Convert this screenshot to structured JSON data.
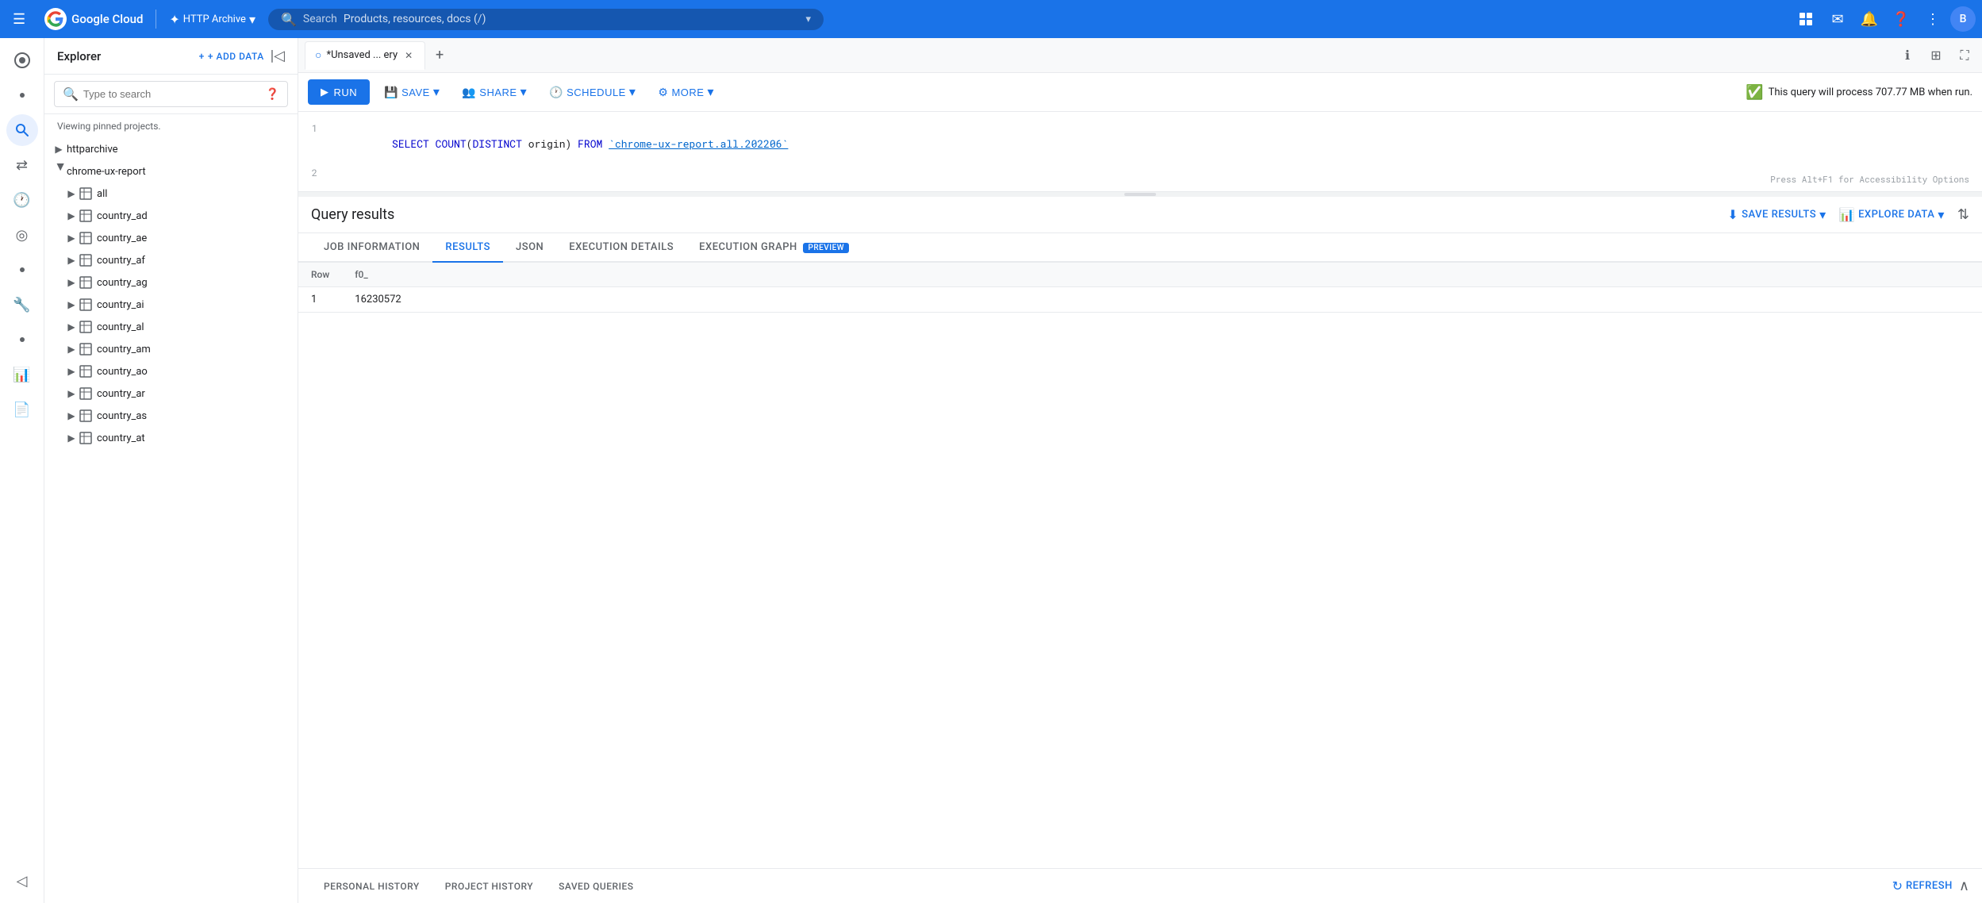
{
  "topNav": {
    "hamburger": "☰",
    "logoText": "Google Cloud",
    "projectName": "HTTP Archive",
    "searchLabel": "Search",
    "searchPlaceholder": "Products, resources, docs (/)",
    "icons": [
      "grid_icon",
      "email_icon",
      "bell_icon",
      "help_icon",
      "more_icon"
    ],
    "avatar": "B"
  },
  "explorer": {
    "title": "Explorer",
    "addDataLabel": "+ ADD DATA",
    "searchPlaceholder": "Type to search",
    "viewingText": "Viewing pinned projects.",
    "projects": [
      {
        "name": "httparchive",
        "expanded": false,
        "children": []
      },
      {
        "name": "chrome-ux-report",
        "expanded": true,
        "pinned": true,
        "children": [
          {
            "name": "all",
            "type": "table"
          },
          {
            "name": "country_ad",
            "type": "table"
          },
          {
            "name": "country_ae",
            "type": "table"
          },
          {
            "name": "country_af",
            "type": "table"
          },
          {
            "name": "country_ag",
            "type": "table"
          },
          {
            "name": "country_ai",
            "type": "table"
          },
          {
            "name": "country_al",
            "type": "table"
          },
          {
            "name": "country_am",
            "type": "table"
          },
          {
            "name": "country_ao",
            "type": "table"
          },
          {
            "name": "country_ar",
            "type": "table"
          },
          {
            "name": "country_as",
            "type": "table"
          },
          {
            "name": "country_at",
            "type": "table"
          }
        ]
      }
    ]
  },
  "queryTab": {
    "tabLabel": "*Unsaved ... ery",
    "tabIcon": "○"
  },
  "queryToolbar": {
    "runLabel": "RUN",
    "saveLabel": "SAVE",
    "shareLabel": "SHARE",
    "scheduleLabel": "SCHEDULE",
    "moreLabel": "MORE",
    "queryInfo": "This query will process 707.77 MB when run."
  },
  "codeEditor": {
    "lines": [
      {
        "num": "1",
        "html": "SELECT COUNT(DISTINCT origin) FROM `chrome-ux-report.all.202206`"
      },
      {
        "num": "2",
        "html": ""
      }
    ],
    "accessibilityHint": "Press Alt+F1 for Accessibility Options"
  },
  "queryResults": {
    "title": "Query results",
    "saveResultsLabel": "SAVE RESULTS",
    "exploreDataLabel": "EXPLORE DATA",
    "tabs": [
      {
        "label": "JOB INFORMATION",
        "active": false
      },
      {
        "label": "RESULTS",
        "active": true
      },
      {
        "label": "JSON",
        "active": false
      },
      {
        "label": "EXECUTION DETAILS",
        "active": false
      },
      {
        "label": "EXECUTION GRAPH",
        "active": false,
        "badge": "PREVIEW"
      }
    ],
    "table": {
      "columns": [
        "Row",
        "f0_"
      ],
      "rows": [
        {
          "row": "1",
          "value": "16230572"
        }
      ]
    }
  },
  "bottomBar": {
    "tabs": [
      {
        "label": "PERSONAL HISTORY"
      },
      {
        "label": "PROJECT HISTORY"
      },
      {
        "label": "SAVED QUERIES"
      }
    ],
    "refreshLabel": "REFRESH"
  },
  "icons": {
    "hamburger": "☰",
    "search": "🔍",
    "chevronDown": "▾",
    "chevronRight": "▶",
    "chevronLeft": "◀",
    "add": "+",
    "close": "✕",
    "pin": "📌",
    "more": "⋮",
    "run": "▶",
    "save": "💾",
    "share": "👥",
    "schedule": "🕐",
    "settings": "⚙",
    "info": "ℹ",
    "tableView": "⊞",
    "expand": "⛶",
    "download": "⬇",
    "chart": "📊",
    "updown": "⇅",
    "refresh": "↻",
    "collapseUp": "∧"
  }
}
